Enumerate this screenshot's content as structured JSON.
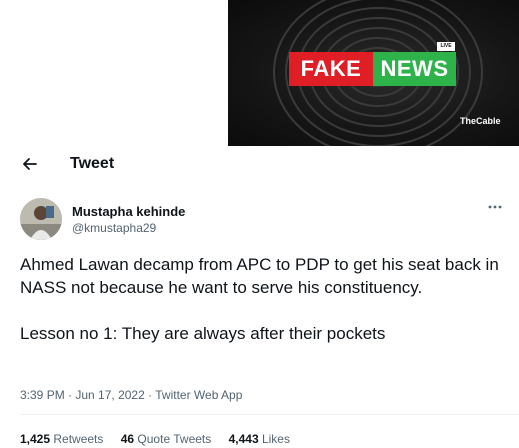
{
  "banner": {
    "live_label": "LIVE",
    "fake_label": "FAKE",
    "news_label": "NEWS",
    "logo_text": "TheCable",
    "colors": {
      "fake": "#e01e26",
      "news": "#2db34a",
      "background": "#141414"
    }
  },
  "header": {
    "title": "Tweet",
    "back_icon": "arrow-left-icon"
  },
  "author": {
    "display_name": "Mustapha kehinde",
    "handle": "@kmustapha29",
    "more_icon": "more-horizontal-icon"
  },
  "tweet": {
    "line1": "Ahmed Lawan decamp from APC to PDP to get his seat back in NASS not because he want to serve his constituency.",
    "line2": "Lesson no 1: They are always after their pockets"
  },
  "meta": {
    "time": "3:39 PM",
    "separator": " · ",
    "date": "Jun 17, 2022",
    "source": "Twitter Web App"
  },
  "stats": {
    "retweets_count": "1,425",
    "retweets_label": " Retweets",
    "quotes_count": "46",
    "quotes_label": " Quote Tweets",
    "likes_count": "4,443",
    "likes_label": " Likes"
  }
}
